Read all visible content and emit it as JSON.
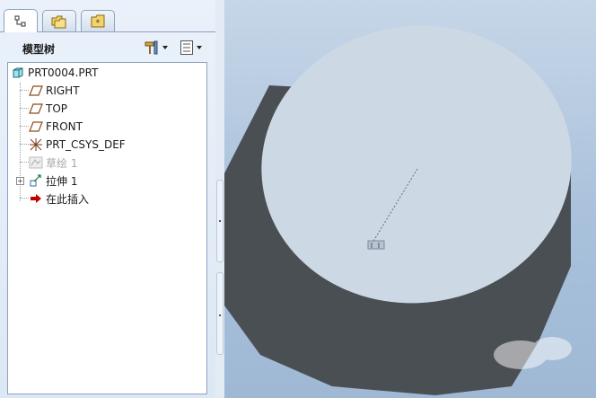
{
  "tabs": [
    {
      "name": "model-tree-tab",
      "icon": "model-tree-icon",
      "active": true
    },
    {
      "name": "folder-browser-tab",
      "icon": "folder-icon",
      "active": false
    },
    {
      "name": "favorites-tab",
      "icon": "star-folder-icon",
      "active": false
    }
  ],
  "tree_header": {
    "title": "模型树",
    "settings_icon": "hammer-settings-icon",
    "show_icon": "list-show-icon"
  },
  "tree": {
    "items": [
      {
        "label": "PRT0004.PRT",
        "icon": "part-icon"
      },
      {
        "label": "RIGHT",
        "icon": "datum-plane-icon"
      },
      {
        "label": "TOP",
        "icon": "datum-plane-icon"
      },
      {
        "label": "FRONT",
        "icon": "datum-plane-icon"
      },
      {
        "label": "PRT_CSYS_DEF",
        "icon": "coordinate-system-icon"
      },
      {
        "label": "草绘 1",
        "icon": "sketch-icon",
        "suppressed": true
      },
      {
        "label": "拉伸 1",
        "icon": "extrude-icon",
        "expandable": true
      },
      {
        "label": "在此插入",
        "icon": "insert-here-arrow-icon"
      }
    ]
  },
  "colors": {
    "panel_bg": "#e3ebf5",
    "viewport_bg": "#a9c1db",
    "cylinder_top": "#cdd8e5",
    "cylinder_side": "#4a4f54",
    "insert_arrow": "#c00000"
  }
}
